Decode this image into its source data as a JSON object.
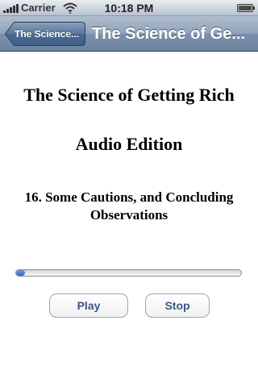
{
  "status_bar": {
    "carrier": "Carrier",
    "time": "10:18 PM",
    "icons": [
      "signal-bars-icon",
      "wifi-icon",
      "battery-icon"
    ]
  },
  "nav_bar": {
    "back_label": "The Science...",
    "title": "The Science of Ge..."
  },
  "content": {
    "book_title": "The Science of Getting Rich",
    "edition": "Audio Edition",
    "chapter": "16. Some Cautions, and Concluding Observations"
  },
  "player": {
    "progress": 0.02,
    "play_label": "Play",
    "stop_label": "Stop"
  },
  "colors": {
    "nav_bar": "#7b90aa",
    "button_text": "#3a5787",
    "progress_fill": "#2f68c6"
  }
}
